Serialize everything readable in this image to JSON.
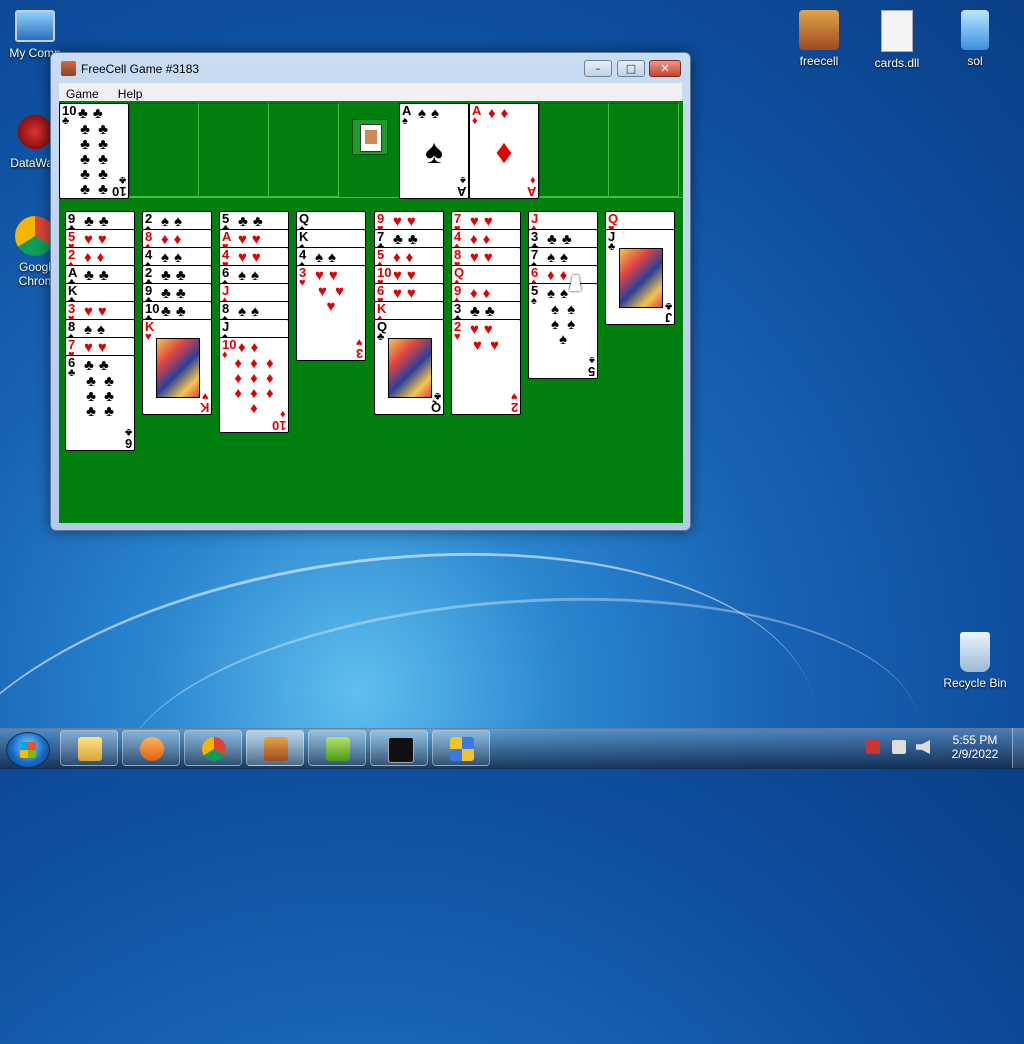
{
  "desktop": {
    "icons": [
      {
        "label": "My Comp",
        "icon": "computer-icon"
      },
      {
        "label": "DataWag",
        "icon": "datawag-icon"
      },
      {
        "label": "Googl",
        "label2": "Chron",
        "icon": "chrome-icon"
      },
      {
        "label": "freecell",
        "icon": "freecell-icon"
      },
      {
        "label": "cards.dll",
        "icon": "dll-file-icon"
      },
      {
        "label": "sol",
        "icon": "sol-icon"
      },
      {
        "label": "Recycle Bin",
        "icon": "recycle-bin-icon"
      }
    ]
  },
  "window": {
    "title": "FreeCell Game #3183",
    "buttons": {
      "minimize": "–",
      "maximize": "□",
      "close": "✕"
    },
    "menu": [
      "Game",
      "Help"
    ]
  },
  "game": {
    "colors": {
      "felt": "#007f0e",
      "red": "#e00000",
      "black": "#000000"
    },
    "freecells": [
      {
        "rank": "10",
        "suit": "♣",
        "color": "black"
      },
      null,
      null,
      null
    ],
    "foundations": [
      {
        "rank": "A",
        "suit": "♠",
        "color": "black"
      },
      {
        "rank": "A",
        "suit": "♦",
        "color": "red"
      },
      null,
      null
    ],
    "columns": [
      [
        {
          "r": "9",
          "s": "♣"
        },
        {
          "r": "5",
          "s": "♥"
        },
        {
          "r": "2",
          "s": "♦"
        },
        {
          "r": "A",
          "s": "♣"
        },
        {
          "r": "K",
          "s": "♣"
        },
        {
          "r": "3",
          "s": "♥"
        },
        {
          "r": "8",
          "s": "♠"
        },
        {
          "r": "7",
          "s": "♥"
        },
        {
          "r": "6",
          "s": "♣"
        }
      ],
      [
        {
          "r": "2",
          "s": "♠"
        },
        {
          "r": "8",
          "s": "♦"
        },
        {
          "r": "4",
          "s": "♠"
        },
        {
          "r": "2",
          "s": "♣"
        },
        {
          "r": "9",
          "s": "♣"
        },
        {
          "r": "10",
          "s": "♣"
        },
        {
          "r": "K",
          "s": "♥"
        }
      ],
      [
        {
          "r": "5",
          "s": "♣"
        },
        {
          "r": "A",
          "s": "♥"
        },
        {
          "r": "4",
          "s": "♥"
        },
        {
          "r": "6",
          "s": "♠"
        },
        {
          "r": "J",
          "s": "♦"
        },
        {
          "r": "8",
          "s": "♠"
        },
        {
          "r": "J",
          "s": "♠"
        },
        {
          "r": "10",
          "s": "♦"
        }
      ],
      [
        {
          "r": "Q",
          "s": "♠"
        },
        {
          "r": "K",
          "s": "♠"
        },
        {
          "r": "4",
          "s": "♠"
        },
        {
          "r": "3",
          "s": "♥"
        }
      ],
      [
        {
          "r": "9",
          "s": "♥"
        },
        {
          "r": "7",
          "s": "♣"
        },
        {
          "r": "5",
          "s": "♦"
        },
        {
          "r": "10",
          "s": "♥"
        },
        {
          "r": "6",
          "s": "♥"
        },
        {
          "r": "K",
          "s": "♦"
        },
        {
          "r": "Q",
          "s": "♣"
        }
      ],
      [
        {
          "r": "7",
          "s": "♥"
        },
        {
          "r": "4",
          "s": "♦"
        },
        {
          "r": "8",
          "s": "♥"
        },
        {
          "r": "Q",
          "s": "♦"
        },
        {
          "r": "9",
          "s": "♦"
        },
        {
          "r": "3",
          "s": "♣"
        },
        {
          "r": "2",
          "s": "♥"
        }
      ],
      [
        {
          "r": "J",
          "s": "♦"
        },
        {
          "r": "3",
          "s": "♣"
        },
        {
          "r": "7",
          "s": "♠"
        },
        {
          "r": "6",
          "s": "♦"
        },
        {
          "r": "5",
          "s": "♠"
        }
      ],
      [
        {
          "r": "Q",
          "s": "♥"
        },
        {
          "r": "J",
          "s": "♣"
        }
      ]
    ]
  },
  "taskbar": {
    "apps": [
      "explorer-icon",
      "media-player-icon",
      "chrome-icon",
      "freecell-icon",
      "notepad-plus-icon",
      "cmd-icon",
      "network-icon"
    ],
    "time": "5:55 PM",
    "date": "2/9/2022"
  }
}
